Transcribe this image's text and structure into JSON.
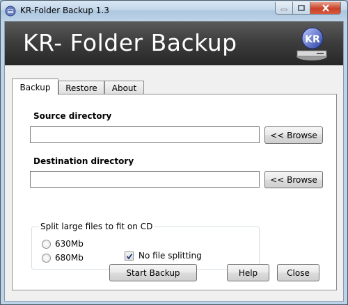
{
  "window": {
    "title": "KR-Folder Backup 1.3",
    "controls": {
      "minimize": "minimize-icon",
      "maximize": "maximize-icon",
      "close": "close-icon"
    }
  },
  "banner": {
    "title": "KR- Folder Backup",
    "logo_text": "KR"
  },
  "tabs": [
    {
      "label": "Backup",
      "active": true
    },
    {
      "label": "Restore",
      "active": false
    },
    {
      "label": "About",
      "active": false
    }
  ],
  "backup": {
    "source_label": "Source directory",
    "source_value": "",
    "destination_label": "Destination directory",
    "destination_value": "",
    "browse_label": "<< Browse",
    "split_group_title": "Split large files to fit on CD",
    "options": [
      {
        "label": "630Mb",
        "selected": false
      },
      {
        "label": "680Mb",
        "selected": false
      }
    ],
    "no_split_label": "No file splitting",
    "no_split_checked": true,
    "start_label": "Start Backup",
    "help_label": "Help",
    "close_label": "Close"
  },
  "colors": {
    "banner_bg": "#3e3e3e",
    "frame": "#bcd3e8",
    "close_button": "#c7422a"
  }
}
